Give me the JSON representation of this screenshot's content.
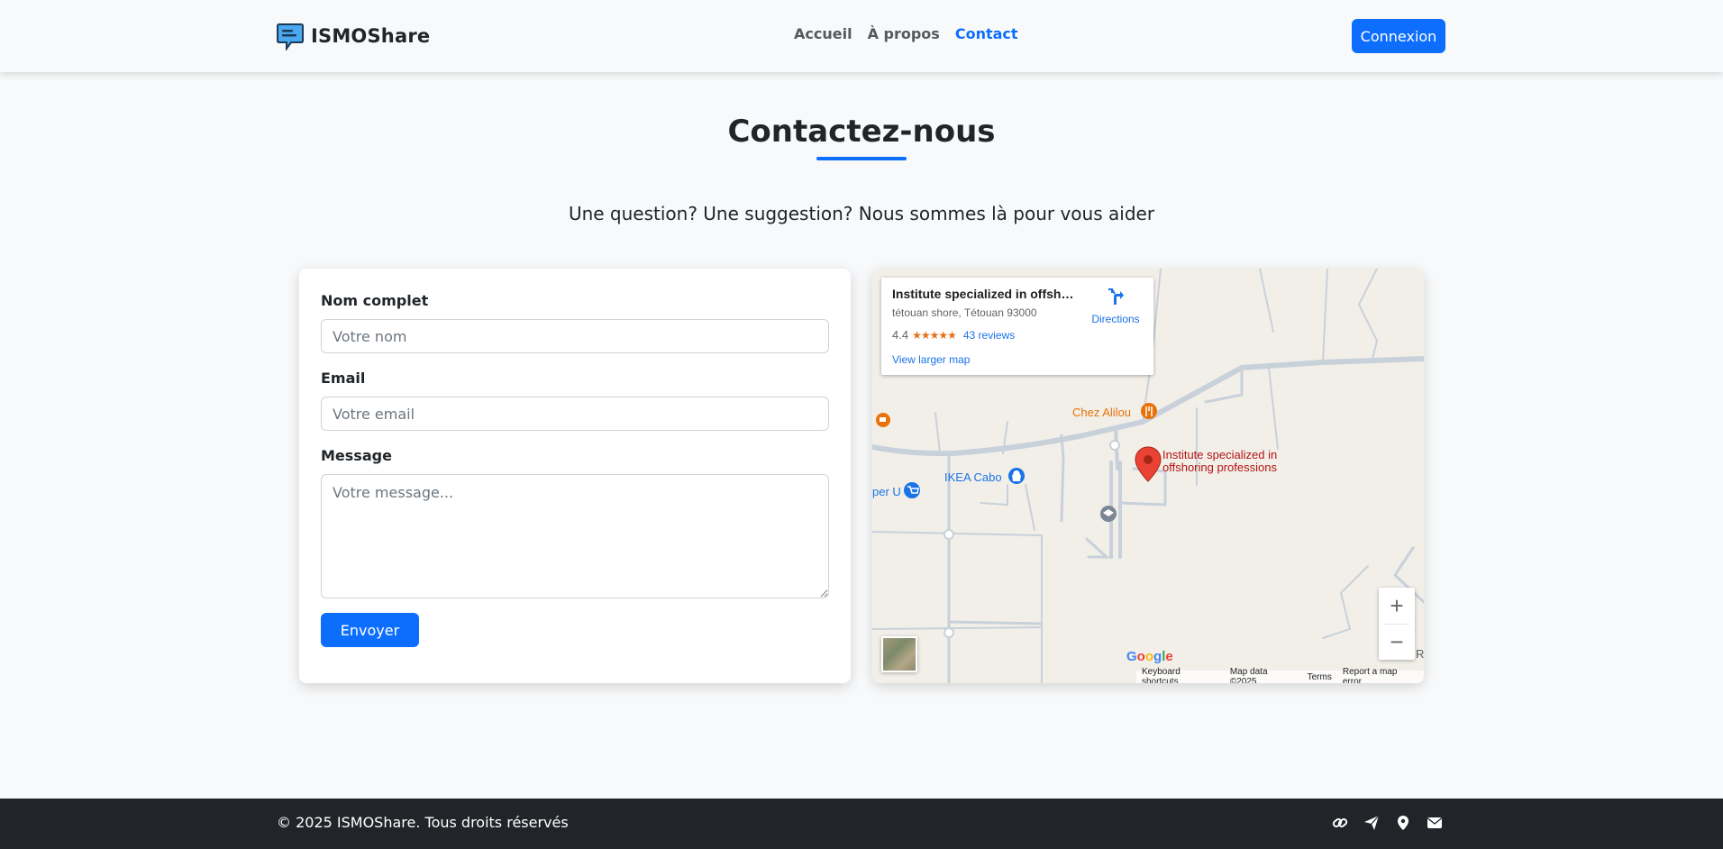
{
  "navbar": {
    "brand": "ISMOShare",
    "links": [
      "Accueil",
      "À propos",
      "Contact"
    ],
    "login_label": "Connexion"
  },
  "page": {
    "title": "Contactez-nous",
    "subtitle": "Une question? Une suggestion? Nous sommes là pour vous aider"
  },
  "form": {
    "name_label": "Nom complet",
    "name_placeholder": "Votre nom",
    "email_label": "Email",
    "email_placeholder": "Votre email",
    "message_label": "Message",
    "message_placeholder": "Votre message...",
    "submit_label": "Envoyer"
  },
  "map": {
    "place_name": "Institute specialized in offshor...",
    "place_address": "tétouan shore, Tétouan 93000",
    "rating": "4.4",
    "stars": "★★★★★",
    "reviews": "43 reviews",
    "larger_map": "View larger map",
    "directions": "Directions",
    "pin_label_line1": "Institute specialized in",
    "pin_label_line2": "offshoring professions",
    "poi_chez_alilou": "Chez Alilou",
    "poi_ikea": "IKEA Cabo",
    "poi_super_u": "per U",
    "poi_edge": "R",
    "zoom_in": "+",
    "zoom_out": "−",
    "attribution": [
      "Keyboard shortcuts",
      "Map data ©2025",
      "Terms",
      "Report a map error"
    ]
  },
  "footer": {
    "copyright": "© 2025 ISMOShare. Tous droits réservés",
    "icons": [
      "link-icon",
      "paper-plane-icon",
      "map-pin-icon",
      "envelope-icon"
    ]
  },
  "colors": {
    "primary": "#0d6efd",
    "dark": "#212529",
    "background": "#f8f9fa",
    "map_land": "#f2efe9",
    "map_road": "#c8d1da",
    "pin_red": "#ea4335",
    "pin_label": "#b31412",
    "poi_orange": "#e8710a",
    "poi_blue": "#1a73e8"
  }
}
